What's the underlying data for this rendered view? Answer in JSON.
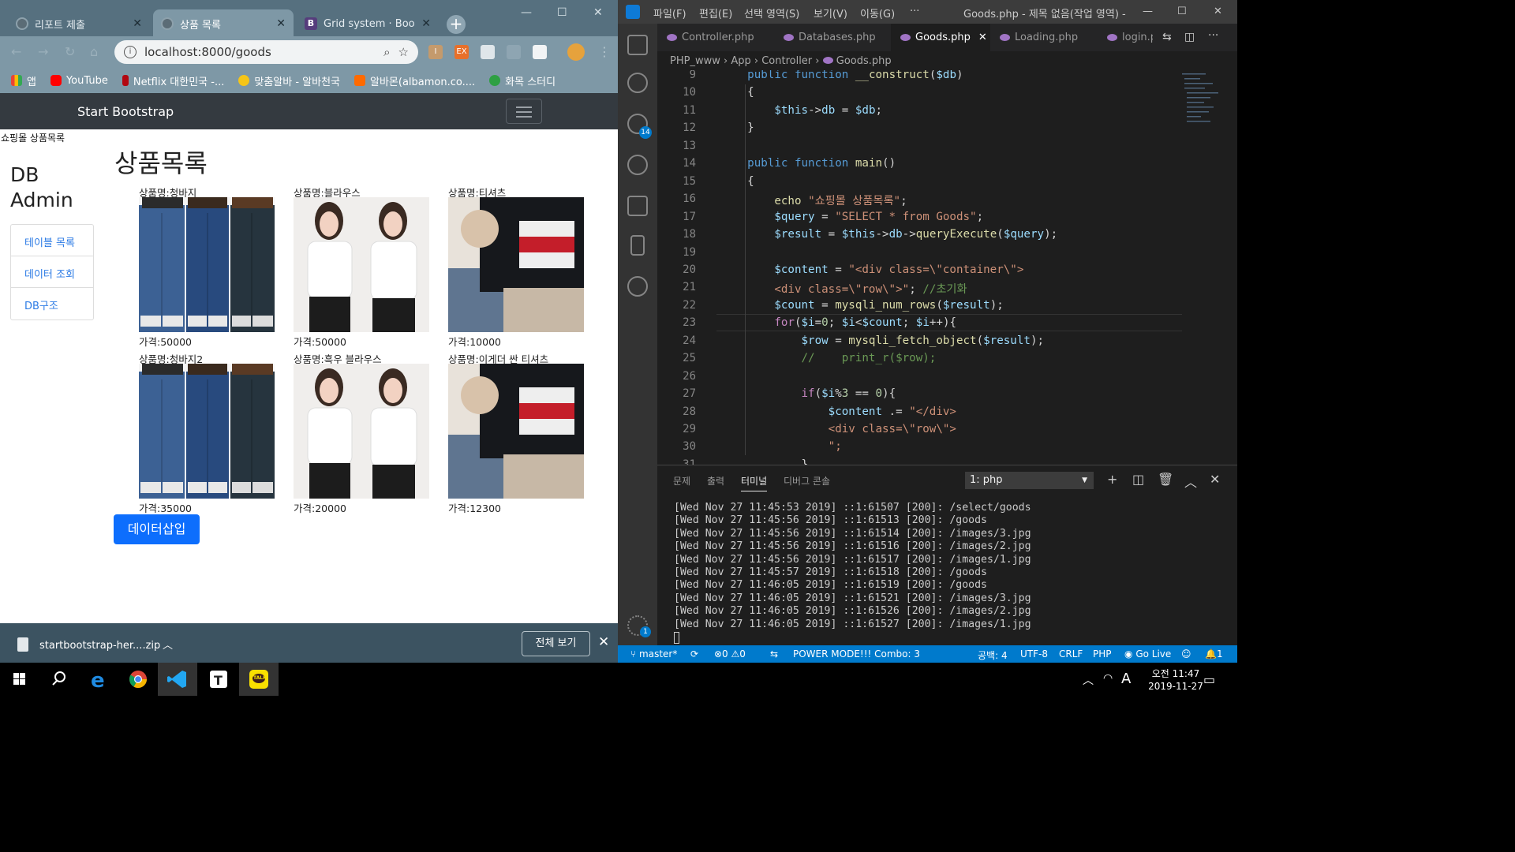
{
  "browser": {
    "tabs": [
      {
        "title": "리포트 제출",
        "icon": "globe-icon"
      },
      {
        "title": "상품 목록",
        "icon": "globe-icon",
        "active": true
      },
      {
        "title": "Grid system · Bootstr",
        "icon": "bootstrap-icon"
      }
    ],
    "url": "localhost:8000/goods",
    "bookmarks": [
      {
        "label": "앱",
        "icon": "apps-icon"
      },
      {
        "label": "YouTube",
        "icon": "youtube-icon"
      },
      {
        "label": "Netflix 대한민국 -...",
        "icon": "netflix-icon"
      },
      {
        "label": "맞춤알바 - 알바천국",
        "icon": "albachunkuk-icon"
      },
      {
        "label": "알바몬(albamon.co....",
        "icon": "albamon-icon"
      },
      {
        "label": "화목 스터디",
        "icon": "frog-icon"
      }
    ],
    "download": {
      "file": "startbootstrap-her....zip",
      "show_all": "전체 보기"
    }
  },
  "page": {
    "brand": "Start Bootstrap",
    "echo": "쇼핑몰 상품목록",
    "sidebar_title": "DB\nAdmin",
    "sidebar_menu": [
      "테이블 목록",
      "데이터 조회",
      "DB구조"
    ],
    "title": "상품목록",
    "products": [
      {
        "name": "상품명:청바지",
        "price": "가격:50000",
        "image": "jeans"
      },
      {
        "name": "상품명:블라우스",
        "price": "가격:50000",
        "image": "blouse"
      },
      {
        "name": "상품명:티셔츠",
        "price": "가격:10000",
        "image": "tshirt"
      },
      {
        "name": "상품명:청바지2",
        "price": "가격:35000",
        "image": "jeans"
      },
      {
        "name": "상품명:흑우 블라우스",
        "price": "가격:20000",
        "image": "blouse"
      },
      {
        "name": "상품명:이게더 싼 티셔츠",
        "price": "가격:12300",
        "image": "tshirt"
      }
    ],
    "insert_button": "데이터삽입"
  },
  "vscode": {
    "menu": [
      "파일(F)",
      "편집(E)",
      "선택 영역(S)",
      "보기(V)",
      "이동(G)",
      "···"
    ],
    "window_title": "Goods.php - 제목 없음(작업 영역) - ...",
    "tabs": [
      "Controller.php",
      "Databases.php",
      "Goods.php",
      "Loading.php",
      "login.p"
    ],
    "active_tab": "Goods.php",
    "breadcrumb": [
      "PHP_www",
      "App",
      "Controller",
      "Goods.php"
    ],
    "scm_badge": "14",
    "settings_badge": "1",
    "code_lines": [
      {
        "n": "9",
        "html": "    <span class=k>public</span> <span class=k>function</span> <span class=f>__construct</span>(<span class=v>$db</span>)"
      },
      {
        "n": "10",
        "html": "    {"
      },
      {
        "n": "11",
        "html": "        <span class=v>$this</span>-><span class=v>db</span> = <span class=v>$db</span>;"
      },
      {
        "n": "12",
        "html": "    }"
      },
      {
        "n": "13",
        "html": ""
      },
      {
        "n": "14",
        "html": "    <span class=k>public</span> <span class=k>function</span> <span class=f>main</span>()"
      },
      {
        "n": "15",
        "html": "    {"
      },
      {
        "n": "16",
        "html": "        <span class=f>echo</span> <span class=s>\"쇼핑몰 상품목록\"</span>;"
      },
      {
        "n": "17",
        "html": "        <span class=v>$query</span> = <span class=s>\"SELECT * from Goods\"</span>;"
      },
      {
        "n": "18",
        "html": "        <span class=v>$result</span> = <span class=v>$this</span>-><span class=v>db</span>-><span class=f>queryExecute</span>(<span class=v>$query</span>);"
      },
      {
        "n": "19",
        "html": ""
      },
      {
        "n": "20",
        "html": "        <span class=v>$content</span> = <span class=s>\"&lt;div class=\\\"container\\\"&gt;</span>"
      },
      {
        "n": "21",
        "html": "        <span class=s>&lt;div class=\\\"row\\\"&gt;\"</span>; <span class=c>//초기화</span>"
      },
      {
        "n": "22",
        "html": "        <span class=v>$count</span> = <span class=f>mysqli_num_rows</span>(<span class=v>$result</span>);"
      },
      {
        "n": "23",
        "html": "        <span class=p>for</span>(<span class=v>$i</span>=<span class=n>0</span>; <span class=v>$i</span>&lt;<span class=v>$count</span>; <span class=v>$i</span>++){"
      },
      {
        "n": "24",
        "html": "            <span class=v>$row</span> = <span class=f>mysqli_fetch_object</span>(<span class=v>$result</span>);"
      },
      {
        "n": "25",
        "html": "            <span class=c>//    print_r($row);</span>"
      },
      {
        "n": "26",
        "html": ""
      },
      {
        "n": "27",
        "html": "            <span class=p>if</span>(<span class=v>$i</span>%<span class=n>3</span> == <span class=n>0</span>){"
      },
      {
        "n": "28",
        "html": "                <span class=v>$content</span> .= <span class=s>\"&lt;/div&gt;</span>"
      },
      {
        "n": "29",
        "html": "                <span class=s>&lt;div class=\\\"row\\\"&gt;</span>"
      },
      {
        "n": "30",
        "html": "                <span class=s>\";</span>"
      },
      {
        "n": "31",
        "html": "            }"
      }
    ],
    "panel_tabs": [
      "문제",
      "출력",
      "터미널",
      "디버그 콘솔"
    ],
    "active_panel_tab": "터미널",
    "terminal_select": "1: php",
    "terminal_lines": [
      "[Wed Nov 27 11:45:53 2019] ::1:61507 [200]: /select/goods",
      "[Wed Nov 27 11:45:56 2019] ::1:61513 [200]: /goods",
      "[Wed Nov 27 11:45:56 2019] ::1:61514 [200]: /images/3.jpg",
      "[Wed Nov 27 11:45:56 2019] ::1:61516 [200]: /images/2.jpg",
      "[Wed Nov 27 11:45:56 2019] ::1:61517 [200]: /images/1.jpg",
      "[Wed Nov 27 11:45:57 2019] ::1:61518 [200]: /goods",
      "[Wed Nov 27 11:46:05 2019] ::1:61519 [200]: /goods",
      "[Wed Nov 27 11:46:05 2019] ::1:61521 [200]: /images/3.jpg",
      "[Wed Nov 27 11:46:05 2019] ::1:61526 [200]: /images/2.jpg",
      "[Wed Nov 27 11:46:05 2019] ::1:61527 [200]: /images/1.jpg"
    ],
    "status": {
      "branch": "master*",
      "errors": "⊗0 ⚠0",
      "power_mode": "POWER MODE!!! Combo: 3",
      "spaces": "공백: 4",
      "encoding": "UTF-8",
      "eol": "CRLF",
      "language": "PHP",
      "golive": "Go Live",
      "notifications": "1"
    }
  },
  "taskbar": {
    "apps": [
      "start-icon",
      "search-icon",
      "edge-icon",
      "chrome-icon",
      "vscode-icon",
      "typora-icon",
      "kakaotalk-icon"
    ],
    "kakao_label": "TALK",
    "ime": "A",
    "time": "오전 11:47",
    "date": "2019-11-27"
  }
}
